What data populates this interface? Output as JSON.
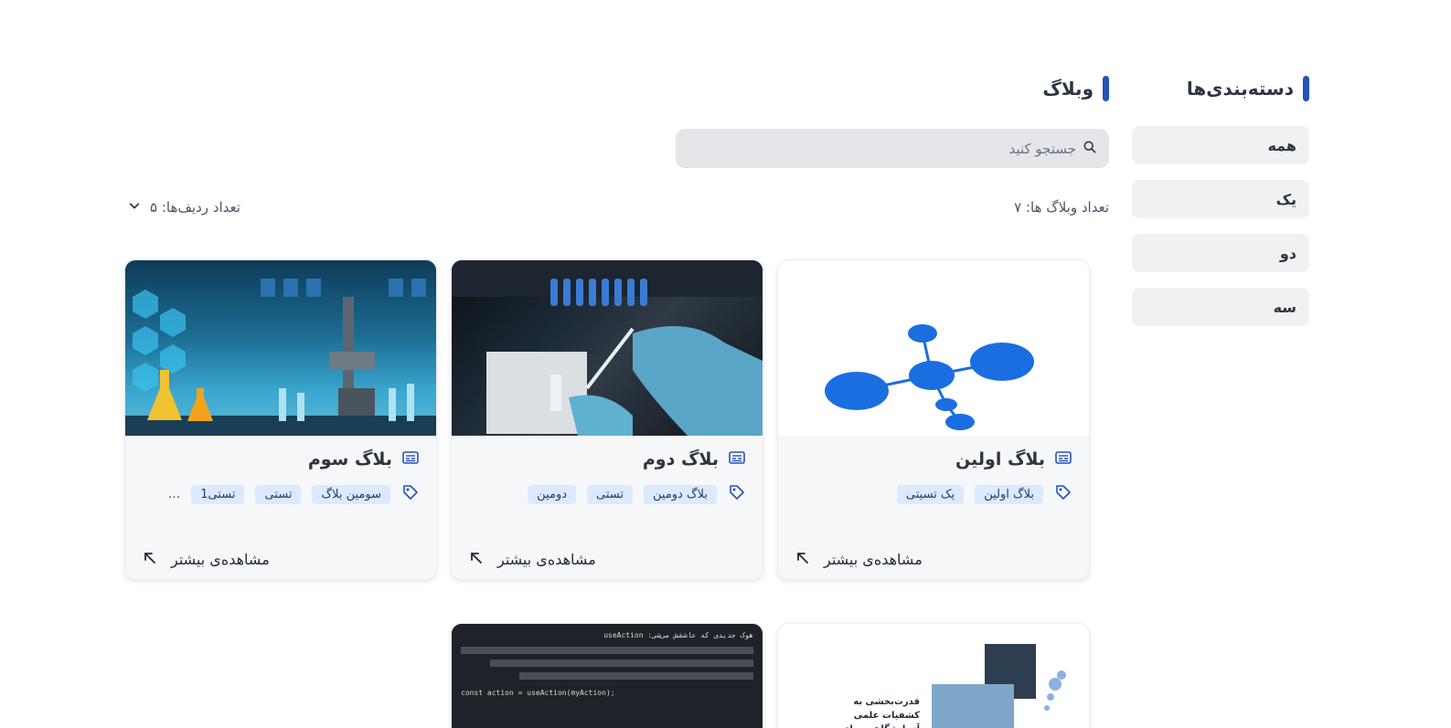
{
  "sidebar": {
    "title": "دسته‌بندی‌ها",
    "items": [
      {
        "label": "همه"
      },
      {
        "label": "یک"
      },
      {
        "label": "دو"
      },
      {
        "label": "سه"
      }
    ]
  },
  "main": {
    "title": "وبلاگ",
    "search_placeholder": "جستجو کنید",
    "blog_count": "تعداد وبلاگ ها: ۷",
    "rows_count": "تعداد ردیف‌ها: ۵"
  },
  "cards": [
    {
      "title": "بلاگ اولین",
      "tags": [
        "بلاگ اولین",
        "یک تسیتی"
      ],
      "more": "مشاهده‌ی بیشتر",
      "image": "molecule-illustration"
    },
    {
      "title": "بلاگ دوم",
      "tags": [
        "بلاگ دومین",
        "تستی",
        "دومین"
      ],
      "more": "مشاهده‌ی بیشتر",
      "image": "lab-gloves-photo"
    },
    {
      "title": "بلاگ سوم",
      "tags": [
        "سومین بلاگ",
        "تستی",
        "تستی1"
      ],
      "ellipsis": "...",
      "more": "مشاهده‌ی بیشتر",
      "image": "lab-equipment-photo"
    }
  ],
  "partial_cards": [
    {
      "image": "lab-article-thumbnail",
      "headline": "قدرت‌بخشی به کشفیات علمی آزمایشگاهی برای آینده."
    },
    {
      "image": "code-screenshot",
      "lines": [
        "هوک جدیدی که عاشقش می‌شی: useAction",
        "const action = useAction(myAction);"
      ]
    }
  ],
  "icons": {
    "search": "search-icon",
    "chevron": "chevron-down-icon",
    "article": "article-icon",
    "tag": "tag-icon",
    "arrow": "arrow-up-left-icon"
  },
  "colors": {
    "accent": "#2453b8",
    "tag_bg": "#dbeafe",
    "molecule": "#1a6ee0"
  }
}
